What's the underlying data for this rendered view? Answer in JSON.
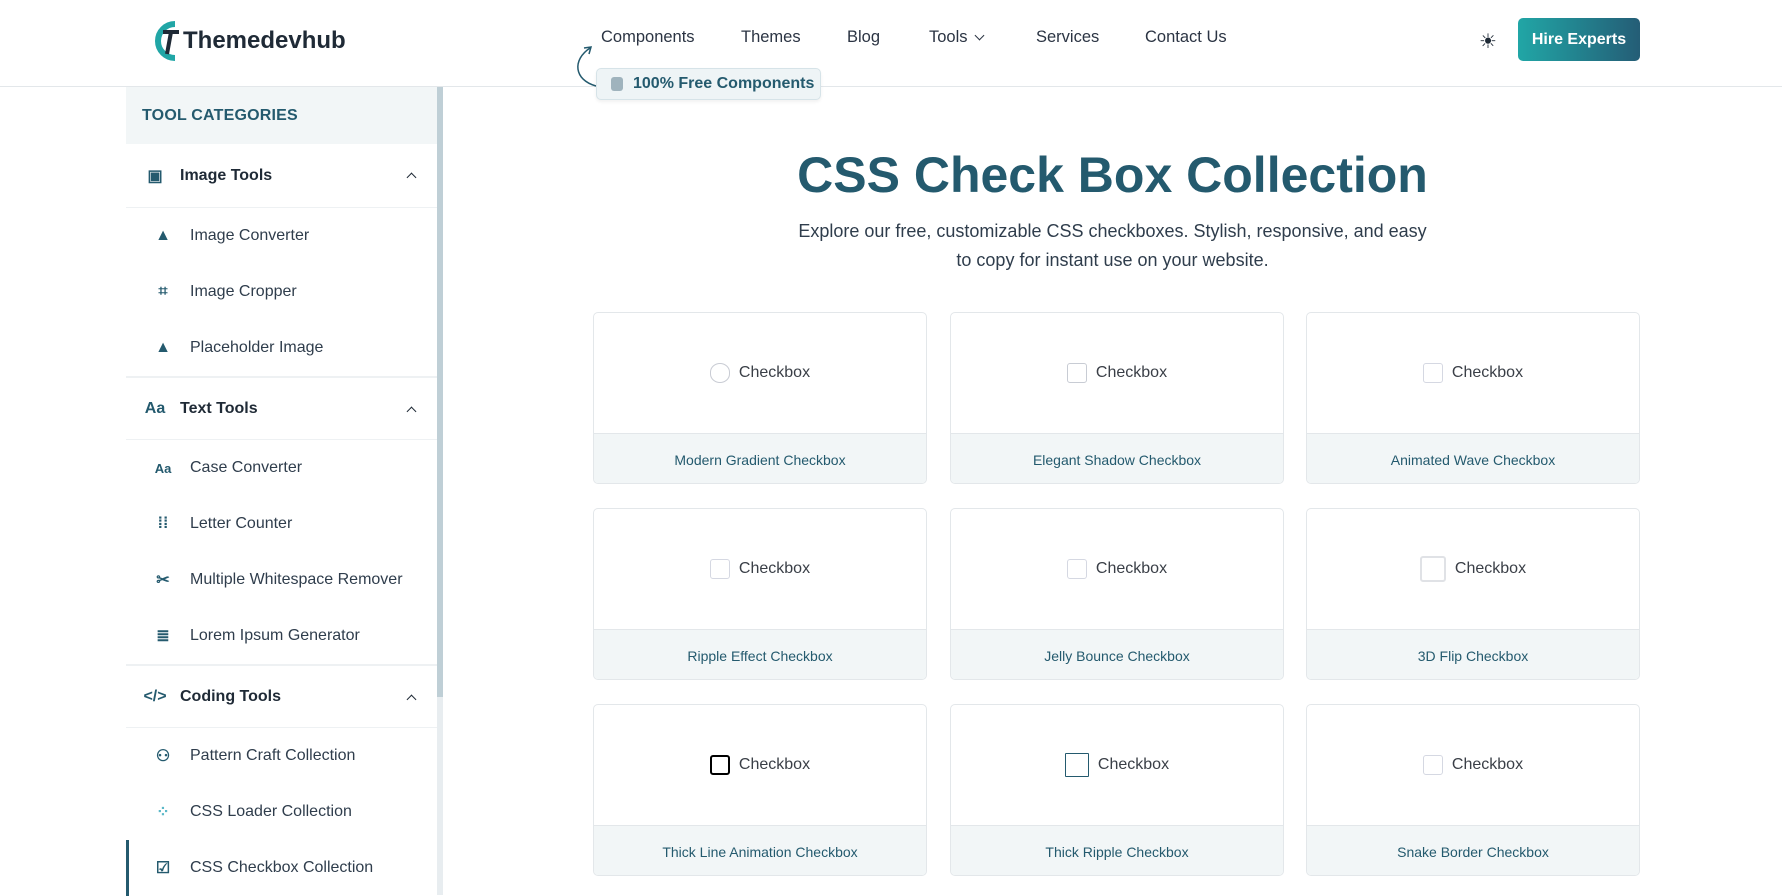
{
  "header": {
    "brand": "Themedevhub",
    "nav": [
      "Components",
      "Themes",
      "Blog",
      "Tools",
      "Services",
      "Contact Us"
    ],
    "badge": "100% Free Components",
    "hire": "Hire Experts",
    "accent": "#245a6e"
  },
  "sidebar": {
    "heading": "TOOL CATEGORIES",
    "groups": [
      {
        "label": "Image Tools",
        "items": [
          "Image Converter",
          "Image Cropper",
          "Placeholder Image"
        ]
      },
      {
        "label": "Text Tools",
        "items": [
          "Case Converter",
          "Letter Counter",
          "Multiple Whitespace Remover",
          "Lorem Ipsum Generator"
        ]
      },
      {
        "label": "Coding Tools",
        "items": [
          "Pattern Craft Collection",
          "CSS Loader Collection",
          "CSS Checkbox Collection"
        ]
      }
    ]
  },
  "main": {
    "title": "CSS Check Box Collection",
    "subtitle1": "Explore our free, customizable CSS checkboxes. Stylish, responsive, and easy",
    "subtitle2": "to copy for instant use on your website.",
    "checkbox_label": "Checkbox",
    "cards": [
      "Modern Gradient Checkbox",
      "Elegant Shadow Checkbox",
      "Animated Wave Checkbox",
      "Ripple Effect Checkbox",
      "Jelly Bounce Checkbox",
      "3D Flip Checkbox",
      "Thick Line Animation Checkbox",
      "Thick Ripple Checkbox",
      "Snake Border Checkbox"
    ]
  }
}
